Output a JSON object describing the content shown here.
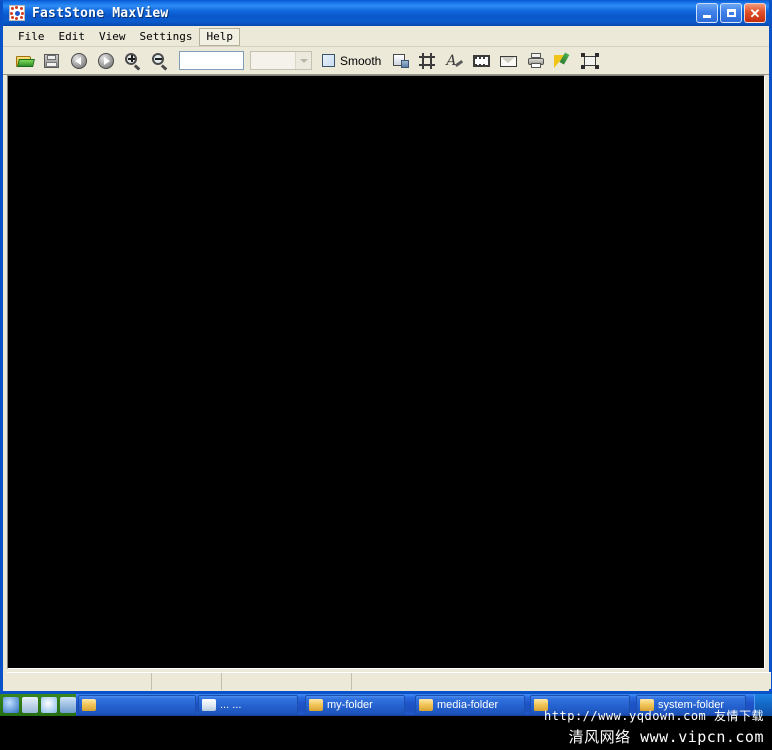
{
  "window": {
    "title": "FastStone MaxView",
    "app_icon": "faststone-icon",
    "caption": {
      "minimize": "_",
      "maximize": "□",
      "close": "✕"
    }
  },
  "menubar": {
    "items": [
      {
        "label": "File",
        "name": "menu-file",
        "hot": false
      },
      {
        "label": "Edit",
        "name": "menu-edit",
        "hot": false
      },
      {
        "label": "View",
        "name": "menu-view",
        "hot": false
      },
      {
        "label": "Settings",
        "name": "menu-settings",
        "hot": false
      },
      {
        "label": "Help",
        "name": "menu-help",
        "hot": true
      }
    ]
  },
  "toolbar": {
    "buttons": [
      {
        "name": "open-folder-icon",
        "title": "Open"
      },
      {
        "name": "save-icon",
        "title": "Save As"
      },
      {
        "name": "previous-image-icon",
        "title": "Previous"
      },
      {
        "name": "next-image-icon",
        "title": "Next"
      },
      {
        "name": "zoom-in-icon",
        "title": "Zoom In"
      },
      {
        "name": "zoom-out-icon",
        "title": "Zoom Out"
      }
    ],
    "zoom_input": {
      "value": "",
      "placeholder": ""
    },
    "mode_combo": {
      "value": "",
      "chevron": "chevron-down-icon"
    },
    "smooth": {
      "label": "Smooth",
      "checked": false
    },
    "buttons_right": [
      {
        "name": "resize-icon",
        "title": "Resize"
      },
      {
        "name": "crop-icon",
        "title": "Crop"
      },
      {
        "name": "draw-icon",
        "title": "Draw / Annotate"
      },
      {
        "name": "slideshow-icon",
        "title": "Slide Show"
      },
      {
        "name": "email-icon",
        "title": "E-mail"
      },
      {
        "name": "print-icon",
        "title": "Print"
      },
      {
        "name": "color-adjust-icon",
        "title": "Adjust Colors"
      },
      {
        "name": "fullscreen-icon",
        "title": "Full Screen"
      }
    ]
  },
  "canvas": {
    "background": "#000000",
    "content": ""
  },
  "statusbar": {
    "panes": [
      "",
      "",
      "",
      ""
    ]
  },
  "taskbar": {
    "start": {
      "label": ""
    },
    "quicklaunch": [
      "quicklaunch-icon-1",
      "quicklaunch-icon-2",
      "quicklaunch-icon-3",
      "quicklaunch-icon-4"
    ],
    "buttons": [
      {
        "label": "",
        "icon": "folder-icon"
      },
      {
        "label": "...  ...",
        "icon": "document-icon"
      },
      {
        "label": "my-folder",
        "icon": "folder-icon"
      },
      {
        "label": "media-folder",
        "icon": "folder-icon"
      },
      {
        "label": "",
        "icon": "folder-icon"
      },
      {
        "label": "system-folder",
        "icon": "folder-icon"
      }
    ],
    "tray": "system-tray"
  },
  "watermarks": {
    "line1": "http://www.yqdown.com 友情下载",
    "line2": "清风网络 www.vipcn.com"
  },
  "colors": {
    "titlebar_blue": "#0a52c7",
    "client_beige": "#ece9d8",
    "canvas_black": "#000000",
    "taskbar_blue": "#245edb",
    "close_red": "#c32d0d"
  }
}
